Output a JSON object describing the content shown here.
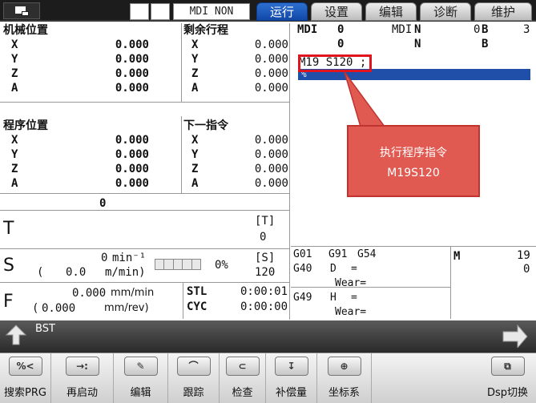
{
  "topbar": {
    "mode": "MDI NON",
    "tabs": [
      "运行",
      "设置",
      "编辑",
      "诊断",
      "维护"
    ],
    "active_tab": 0
  },
  "machine_pos": {
    "title": "机械位置",
    "rows": [
      {
        "axis": "X",
        "value": "0.000"
      },
      {
        "axis": "Y",
        "value": "0.000"
      },
      {
        "axis": "Z",
        "value": "0.000"
      },
      {
        "axis": "A",
        "value": "0.000"
      }
    ]
  },
  "remaining": {
    "title": "剩余行程",
    "rows": [
      {
        "axis": "X",
        "value": "0.000"
      },
      {
        "axis": "Y",
        "value": "0.000"
      },
      {
        "axis": "Z",
        "value": "0.000"
      },
      {
        "axis": "A",
        "value": "0.000"
      }
    ]
  },
  "program_pos": {
    "title": "程序位置",
    "rows": [
      {
        "axis": "X",
        "value": "0.000"
      },
      {
        "axis": "Y",
        "value": "0.000"
      },
      {
        "axis": "Z",
        "value": "0.000"
      },
      {
        "axis": "A",
        "value": "0.000"
      }
    ]
  },
  "next_cmd": {
    "title": "下一指令",
    "rows": [
      {
        "axis": "X",
        "value": "0.000"
      },
      {
        "axis": "Y",
        "value": "0.000"
      },
      {
        "axis": "Z",
        "value": "0.000"
      },
      {
        "axis": "A",
        "value": "0.000"
      }
    ]
  },
  "tool": {
    "letter": "T",
    "value": "0",
    "cmd_label": "[T]",
    "cmd_value": "0"
  },
  "spindle": {
    "letter": "S",
    "value": "0",
    "unit": "min⁻¹",
    "paren_value": "0.0",
    "paren_unit": "m/min)",
    "paren_open": "(",
    "load": "0%",
    "cmd_label": "[S]",
    "cmd_value": "120"
  },
  "feed": {
    "letter": "F",
    "value": "0.000",
    "unit": "mm/min",
    "paren_open": "(",
    "rev_value": "0.000",
    "rev_unit": "mm/rev)",
    "stl_label": "STL",
    "stl_value": "0:00:01",
    "cyc_label": "CYC",
    "cyc_value": "0:00:00"
  },
  "mdi_header": {
    "label": "MDI",
    "o1": "0",
    "o2": "0",
    "mdi2": "MDI",
    "n1": "N",
    "n2": "N",
    "z": "0",
    "b1": "B",
    "b2": "B",
    "right_num": "3"
  },
  "program": {
    "line1": "M19 S120 ;",
    "cursor_line": "%"
  },
  "callout": {
    "line1": "执行程序指令",
    "line2": "M19S120"
  },
  "modal": {
    "g1": "G01",
    "g2": "G91",
    "g3": "G54",
    "g4": "G40",
    "d": "D",
    "eq1": "=",
    "wear1": "Wear=",
    "g5": "G49",
    "h": "H",
    "eq2": "=",
    "wear2": "Wear=",
    "m": "M",
    "m_val1": "19",
    "m_val2": "0"
  },
  "status": {
    "bst": "BST"
  },
  "softkeys": [
    {
      "label": "搜索PRG",
      "icon": "%<"
    },
    {
      "label": "再启动",
      "icon": "→:"
    },
    {
      "label": "编辑",
      "icon": "✎"
    },
    {
      "label": "跟踪",
      "icon": "⌒"
    },
    {
      "label": "检查",
      "icon": "⊂"
    },
    {
      "label": "补偿量",
      "icon": "↧"
    },
    {
      "label": "坐标系",
      "icon": "⊕"
    },
    {
      "label": "",
      "icon": ""
    },
    {
      "label": "Dsp切换",
      "icon": "⧉"
    }
  ],
  "colors": {
    "accent": "#1f4fa8",
    "highlight_red": "#e0141c",
    "callout_bg": "#e05a52"
  }
}
